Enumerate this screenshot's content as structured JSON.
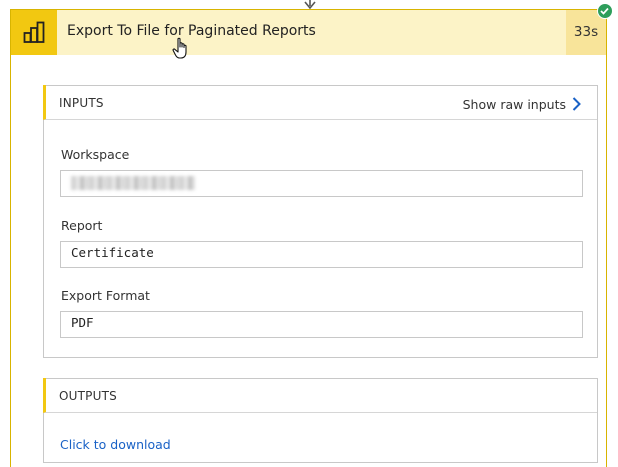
{
  "action": {
    "title": "Export To File for Paginated Reports",
    "duration": "33s",
    "status": "succeeded",
    "icon": "power-bi-icon",
    "accent_color": "#F2C811",
    "header_bg": "#FCF3C7"
  },
  "inputs": {
    "section_title": "INPUTS",
    "show_raw_label": "Show raw inputs",
    "fields": [
      {
        "label": "Workspace",
        "value": "",
        "value_obscured": true
      },
      {
        "label": "Report",
        "value": "Certificate"
      },
      {
        "label": "Export Format",
        "value": "PDF"
      }
    ]
  },
  "outputs": {
    "section_title": "OUTPUTS",
    "download_label": "Click to download",
    "link_color": "#1A62C6"
  }
}
